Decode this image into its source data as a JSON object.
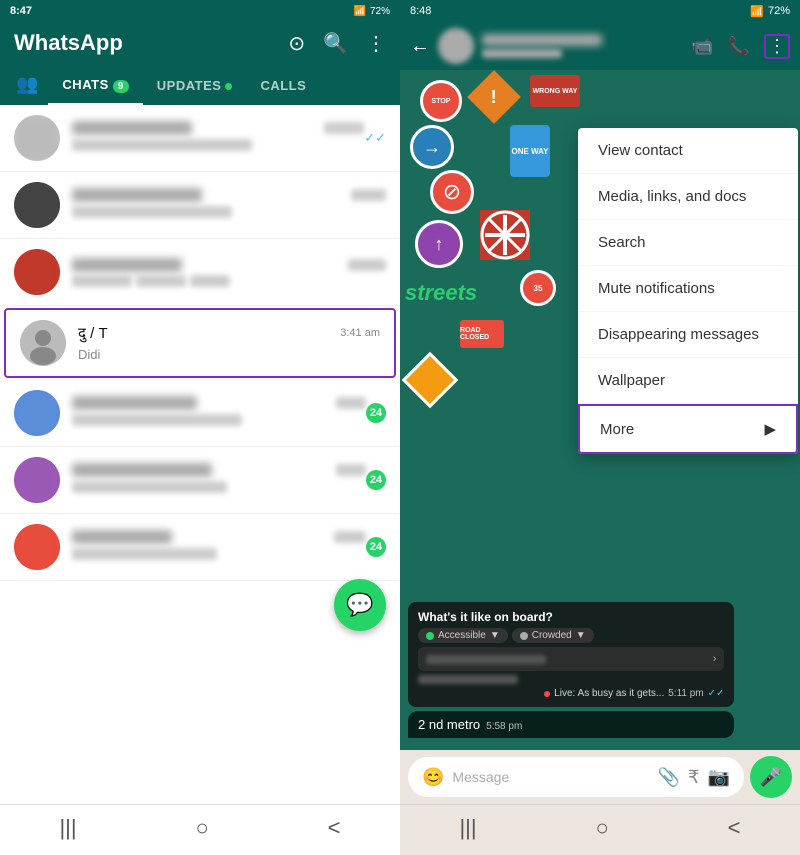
{
  "left": {
    "statusBar": {
      "time": "8:47",
      "icon": "⊙",
      "battery": "72%"
    },
    "appTitle": "WhatsApp",
    "tabs": [
      {
        "id": "contacts",
        "icon": "👥",
        "label": ""
      },
      {
        "id": "chats",
        "label": "Chats",
        "badge": "9",
        "active": true
      },
      {
        "id": "updates",
        "label": "Updates",
        "dot": true
      },
      {
        "id": "calls",
        "label": "Calls"
      }
    ],
    "chats": [
      {
        "id": 1,
        "blurred": true,
        "time": "",
        "preview": "",
        "unread": false,
        "tickColor": "green",
        "avatarColor": "#aaa"
      },
      {
        "id": 2,
        "blurred": true,
        "time": "",
        "preview": "",
        "unread": false,
        "avatarColor": "#444"
      },
      {
        "id": 3,
        "blurred": true,
        "time": "",
        "preview": "",
        "unread": false,
        "avatarColor": "#c0392b"
      },
      {
        "id": 4,
        "blurred": false,
        "time": "3:41 am",
        "name": "दु   / T   ",
        "preview": "Didi",
        "unread": false,
        "avatarColor": "#bbb",
        "highlighted": true
      },
      {
        "id": 5,
        "blurred": true,
        "time": "",
        "preview": "",
        "unread": 24,
        "avatarColor": "#5b8dd9"
      },
      {
        "id": 6,
        "blurred": true,
        "time": "",
        "preview": "",
        "unread": 24,
        "avatarColor": "#9b59b6"
      },
      {
        "id": 7,
        "blurred": true,
        "time": "",
        "preview": "",
        "unread": 24,
        "avatarColor": "#e74c3c"
      }
    ],
    "nav": [
      "|||",
      "○",
      "<"
    ]
  },
  "right": {
    "statusBar": {
      "time": "8:48",
      "battery": "72%"
    },
    "header": {
      "backIcon": "←",
      "videoIcon": "📹",
      "callIcon": "📞",
      "moreIcon": "⋮"
    },
    "dropdown": {
      "items": [
        {
          "id": "view-contact",
          "label": "View contact",
          "hasArrow": false
        },
        {
          "id": "media-links",
          "label": "Media, links, and docs",
          "hasArrow": false
        },
        {
          "id": "search",
          "label": "Search",
          "hasArrow": false
        },
        {
          "id": "mute",
          "label": "Mute notifications",
          "hasArrow": false
        },
        {
          "id": "disappearing",
          "label": "Disappearing messages",
          "hasArrow": false
        },
        {
          "id": "wallpaper",
          "label": "Wallpaper",
          "hasArrow": false
        },
        {
          "id": "more",
          "label": "More",
          "hasArrow": true,
          "highlighted": true
        }
      ]
    },
    "messages": {
      "pollTitle": "What's it like on board?",
      "pollOption1": "Accessible",
      "pollOption2": "Crowded",
      "pollTime": "5:11 pm",
      "pollTicks": "✓✓",
      "metroText": "2 nd metro",
      "metroTime": "5:58 pm",
      "inputPlaceholder": "Message"
    },
    "nav": [
      "|||",
      "○",
      "<"
    ]
  }
}
